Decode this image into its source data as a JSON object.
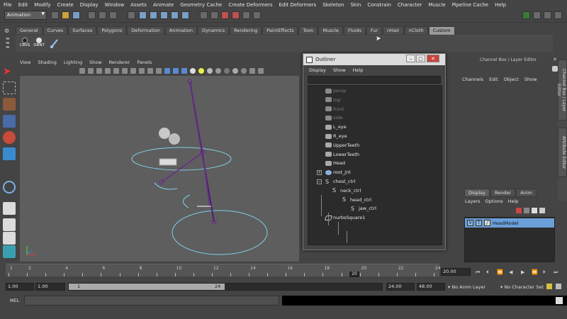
{
  "menu": [
    "File",
    "Edit",
    "Modify",
    "Create",
    "Display",
    "Window",
    "Assets",
    "Animate",
    "Geometry Cache",
    "Create Deformers",
    "Edit Deformers",
    "Skeleton",
    "Skin",
    "Constrain",
    "Character",
    "Muscle",
    "Pipeline Cache",
    "Help"
  ],
  "mode": "Animation",
  "shelf_tabs": [
    "General",
    "Curves",
    "Surfaces",
    "Polygons",
    "Deformation",
    "Animation",
    "Dynamics",
    "Rendering",
    "PaintEffects",
    "Toon",
    "Muscle",
    "Fluids",
    "Fur",
    "nHair",
    "nCloth",
    "Custom"
  ],
  "shelf_active": "Custom",
  "shelf_buttons": [
    "CRVS",
    "ORNT",
    ""
  ],
  "viewport_menu": [
    "View",
    "Shading",
    "Lighting",
    "Show",
    "Renderer",
    "Panels"
  ],
  "outliner": {
    "title": "Outliner",
    "menu": [
      "Display",
      "Show",
      "Help"
    ],
    "items": [
      {
        "label": "persp",
        "dim": true
      },
      {
        "label": "top",
        "dim": true
      },
      {
        "label": "front",
        "dim": true
      },
      {
        "label": "side",
        "dim": true
      },
      {
        "label": "L_eye",
        "dim": false
      },
      {
        "label": "R_eye",
        "dim": false
      },
      {
        "label": "UpperTeeth",
        "dim": false
      },
      {
        "label": "LowerTeeth",
        "dim": false
      },
      {
        "label": "Head",
        "dim": false
      },
      {
        "label": "root_jnt",
        "dim": false
      },
      {
        "label": "chest_ctrl",
        "dim": false
      },
      {
        "label": "neck_ctrl",
        "dim": false
      },
      {
        "label": "head_ctrl",
        "dim": false
      },
      {
        "label": "jaw_ctrl",
        "dim": false
      },
      {
        "label": "nurbsSquare1",
        "dim": false
      }
    ]
  },
  "channel_box": {
    "title": "Channel Box / Layer Editor",
    "menu": [
      "Channels",
      "Edit",
      "Object",
      "Show"
    ],
    "layer_tabs": [
      "Display",
      "Render",
      "Anim"
    ],
    "layer_menu": [
      "Layers",
      "Options",
      "Help"
    ],
    "layer_row": {
      "v": "V",
      "p": "T",
      "name": "HeadModel"
    }
  },
  "side_tabs": [
    "Channel Box / Layer Editor",
    "Attribute Editor"
  ],
  "timeline": {
    "ticks": [
      "1",
      "2",
      "4",
      "6",
      "8",
      "10",
      "12",
      "14",
      "16",
      "18",
      "20",
      "22",
      "24"
    ],
    "current": "20",
    "current_field": "20.00"
  },
  "range": {
    "start": "1.00",
    "start2": "1.00",
    "slider_start": "1",
    "slider_end": "24",
    "end": "24.00",
    "end2": "48.00",
    "anim_layer": "No Anim Layer",
    "char_set": "No Character Set"
  },
  "mel_label": "MEL",
  "colors": {
    "accent": "#6b9fd8",
    "curve": "#7fd0e8",
    "joint": "#6a2a8a"
  }
}
